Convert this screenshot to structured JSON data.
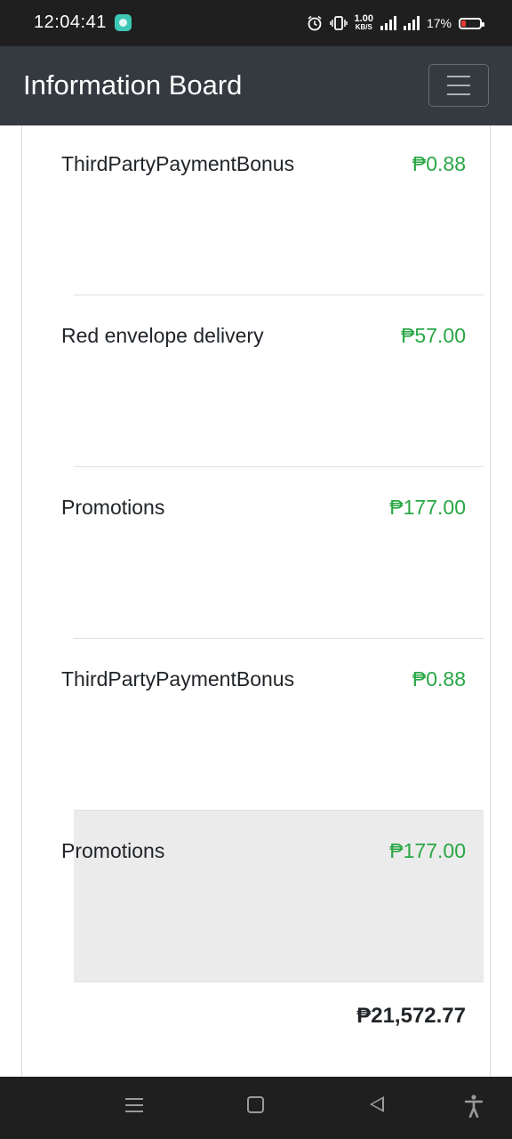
{
  "status_bar": {
    "time": "12:04:41",
    "net_speed_value": "1.00",
    "net_speed_unit": "KB/S",
    "battery": "17%"
  },
  "navbar": {
    "title": "Information Board",
    "menu_icon": "hamburger-menu-icon"
  },
  "transactions": [
    {
      "description": "ThirdPartyPaymentBonus",
      "amount": "₱0.88",
      "active": false
    },
    {
      "description": "Red envelope delivery",
      "amount": "₱57.00",
      "active": false
    },
    {
      "description": "Promotions",
      "amount": "₱177.00",
      "active": false
    },
    {
      "description": "ThirdPartyPaymentBonus",
      "amount": "₱0.88",
      "active": false
    },
    {
      "description": "Promotions",
      "amount": "₱177.00",
      "active": true
    }
  ],
  "total": "₱21,572.77",
  "colors": {
    "navbar_bg": "#343a40",
    "amount_green": "#28a745",
    "active_row_bg": "#ebebeb",
    "system_bar_bg": "#1f1f1f"
  },
  "system_nav": {
    "icons": [
      "menu-icon",
      "home-icon",
      "back-icon",
      "accessibility-icon"
    ]
  }
}
